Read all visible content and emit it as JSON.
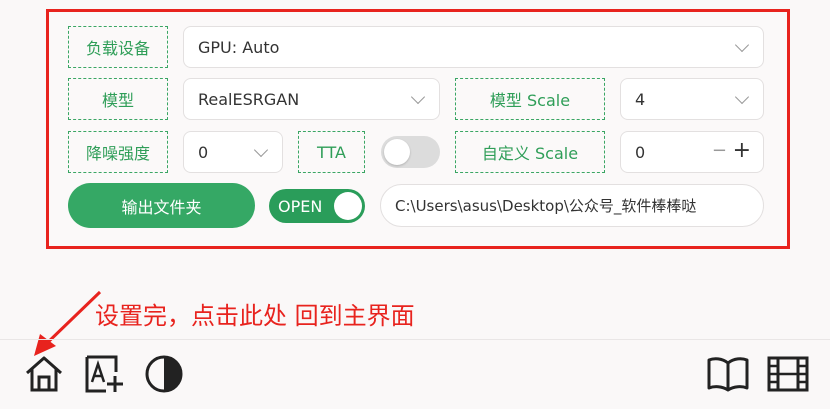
{
  "settings": {
    "device_label": "负载设备",
    "device_value": "GPU: Auto",
    "model_label": "模型",
    "model_value": "RealESRGAN",
    "model_scale_label": "模型 Scale",
    "model_scale_value": "4",
    "denoise_label": "降噪强度",
    "denoise_value": "0",
    "tta_label": "TTA",
    "tta_enabled": false,
    "custom_scale_label": "自定义 Scale",
    "custom_scale_value": "0",
    "stepper_minus": "−",
    "stepper_plus": "+",
    "output_folder_button": "输出文件夹",
    "open_toggle_label": "OPEN",
    "open_enabled": true,
    "output_path": "C:\\Users\\asus\\Desktop\\公众号_软件棒棒哒"
  },
  "annotation": {
    "text": "设置完，点击此处 回到主界面",
    "color": "#e8231e"
  },
  "toolbar": {
    "left_icons": [
      "home-icon",
      "font-add-icon",
      "contrast-icon"
    ],
    "right_icons": [
      "book-icon",
      "film-icon"
    ]
  },
  "colors": {
    "accent_green": "#35a865",
    "highlight_red": "#e8231e"
  }
}
